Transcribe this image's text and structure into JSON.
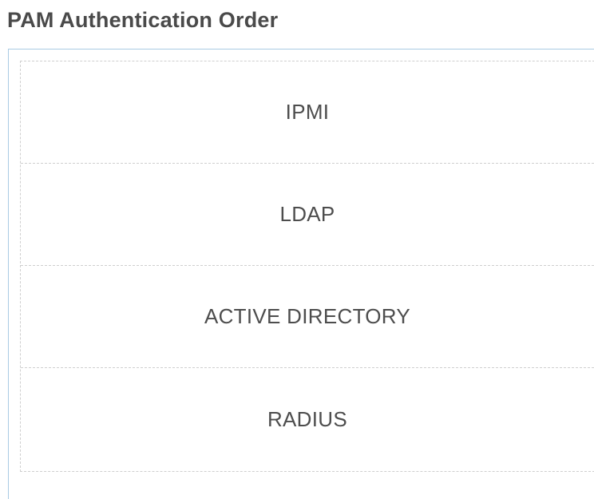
{
  "section": {
    "title": "PAM Authentication Order"
  },
  "order_list": {
    "items": [
      {
        "label": "IPMI"
      },
      {
        "label": "LDAP"
      },
      {
        "label": "ACTIVE DIRECTORY"
      },
      {
        "label": "RADIUS"
      }
    ]
  },
  "colors": {
    "panel_border": "#a9cbe3",
    "dashed_border": "#cfcfcf",
    "title_text": "#4a4a4a",
    "item_text": "#4d4d4d"
  }
}
